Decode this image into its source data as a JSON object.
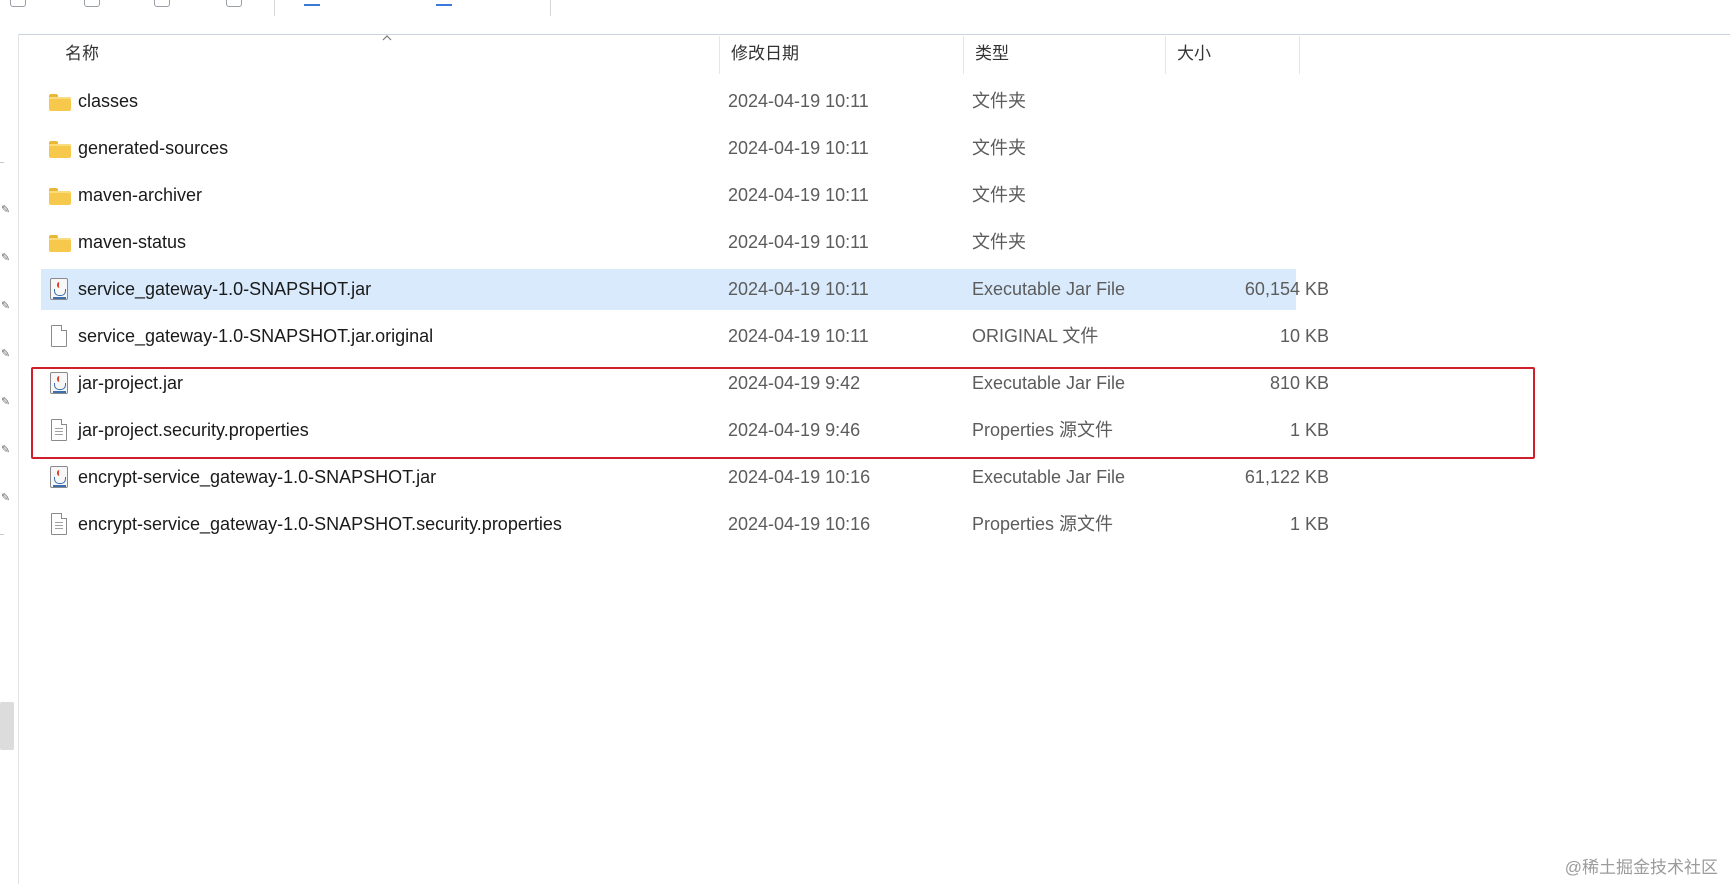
{
  "columns": {
    "name": "名称",
    "date": "修改日期",
    "type": "类型",
    "size": "大小"
  },
  "rows": [
    {
      "icon": "folder-icon",
      "name": "classes",
      "date": "2024-04-19 10:11",
      "type": "文件夹",
      "size": ""
    },
    {
      "icon": "folder-icon",
      "name": "generated-sources",
      "date": "2024-04-19 10:11",
      "type": "文件夹",
      "size": ""
    },
    {
      "icon": "folder-icon",
      "name": "maven-archiver",
      "date": "2024-04-19 10:11",
      "type": "文件夹",
      "size": ""
    },
    {
      "icon": "folder-icon",
      "name": "maven-status",
      "date": "2024-04-19 10:11",
      "type": "文件夹",
      "size": ""
    },
    {
      "icon": "jar-file-icon",
      "name": "service_gateway-1.0-SNAPSHOT.jar",
      "date": "2024-04-19 10:11",
      "type": "Executable Jar File",
      "size": "60,154 KB",
      "selected": true
    },
    {
      "icon": "file-icon",
      "name": "service_gateway-1.0-SNAPSHOT.jar.original",
      "date": "2024-04-19 10:11",
      "type": "ORIGINAL 文件",
      "size": "10 KB"
    },
    {
      "icon": "jar-file-icon",
      "name": "jar-project.jar",
      "date": "2024-04-19 9:42",
      "type": "Executable Jar File",
      "size": "810 KB"
    },
    {
      "icon": "properties-file-icon",
      "name": "jar-project.security.properties",
      "date": "2024-04-19 9:46",
      "type": "Properties 源文件",
      "size": "1 KB"
    },
    {
      "icon": "jar-file-icon",
      "name": "encrypt-service_gateway-1.0-SNAPSHOT.jar",
      "date": "2024-04-19 10:16",
      "type": "Executable Jar File",
      "size": "61,122 KB"
    },
    {
      "icon": "properties-file-icon",
      "name": "encrypt-service_gateway-1.0-SNAPSHOT.security.properties",
      "date": "2024-04-19 10:16",
      "type": "Properties 源文件",
      "size": "1 KB"
    }
  ],
  "colors": {
    "selection": "#d8eafb",
    "highlight_box": "#d01f2b",
    "folder": "#f6c94c"
  },
  "watermark": "@稀土掘金技术社区"
}
